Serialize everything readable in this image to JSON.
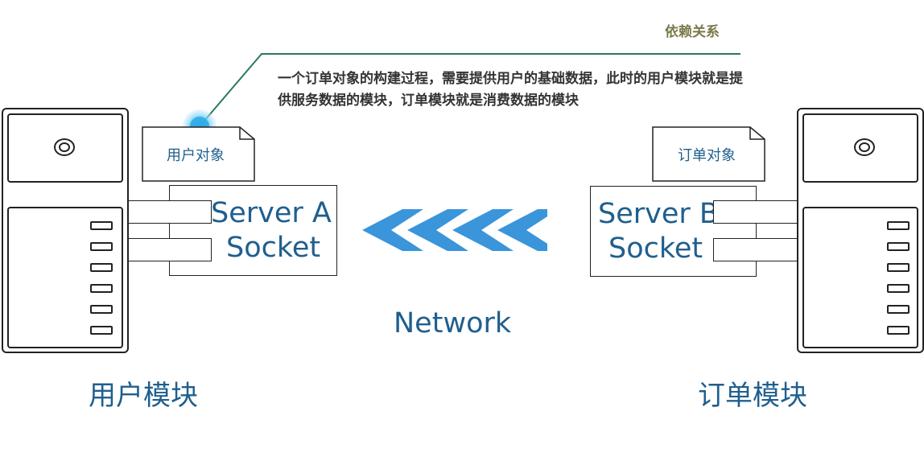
{
  "dependency": {
    "title": "依赖关系",
    "description": "一个订单对象的构建过程，需要提供用户的基础数据，此时的用户模块就是提供服务数据的模块，订单模块就是消费数据的模块"
  },
  "left": {
    "document_label": "用户对象",
    "socket_line1": "Server A",
    "socket_line2": "Socket",
    "module_label": "用户模块"
  },
  "right": {
    "document_label": "订单对象",
    "socket_line1": "Server B",
    "socket_line2": "Socket",
    "module_label": "订单模块"
  },
  "network": {
    "label": "Network",
    "arrow_color": "#3a95da",
    "chevron_count": 4
  },
  "colors": {
    "accent_blue": "#1f5f8e",
    "leader_line": "#2a7a5a",
    "dependency_title": "#7a7a4a"
  }
}
